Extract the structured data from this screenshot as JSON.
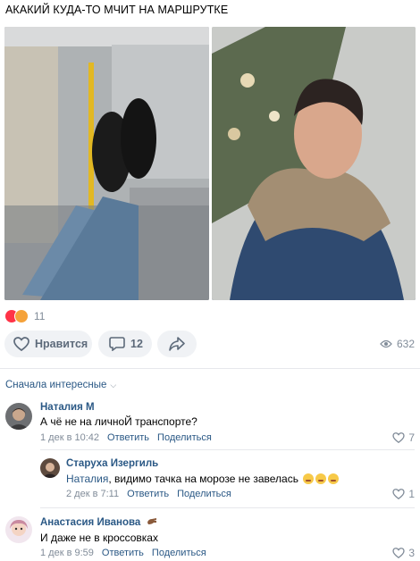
{
  "post": {
    "title": "АКАКИЙ КУДА-ТО МЧИТ НА МАРШРУТКЕ"
  },
  "reactions": {
    "count": "11",
    "icons": [
      "heart-icon",
      "face-icon"
    ]
  },
  "actions": {
    "like_label": "Нравится",
    "comments_count": "12",
    "views_count": "632"
  },
  "comments_section": {
    "sort_label": "Сначала интересные"
  },
  "comments": [
    {
      "author": "Наталия М",
      "text": "А чё не на личноЙ транспорте?",
      "date": "1 дек в 10:42",
      "reply_label": "Ответить",
      "share_label": "Поделиться",
      "likes": "7"
    },
    {
      "author": "Старуха Изергиль",
      "mention": "Наталия",
      "text": ", видимо тачка на морозе не завелась",
      "date": "2 дек в 7:11",
      "reply_label": "Ответить",
      "share_label": "Поделиться",
      "likes": "1"
    },
    {
      "author": "Анастасия Иванова",
      "text": "И даже не в кроссовках",
      "date": "1 дек в 9:59",
      "reply_label": "Ответить",
      "share_label": "Поделиться",
      "likes": "3"
    }
  ],
  "colors": {
    "link": "#2a5885",
    "muted": "#818c99",
    "button_bg": "#f0f2f5",
    "heart": "#ff3347"
  }
}
